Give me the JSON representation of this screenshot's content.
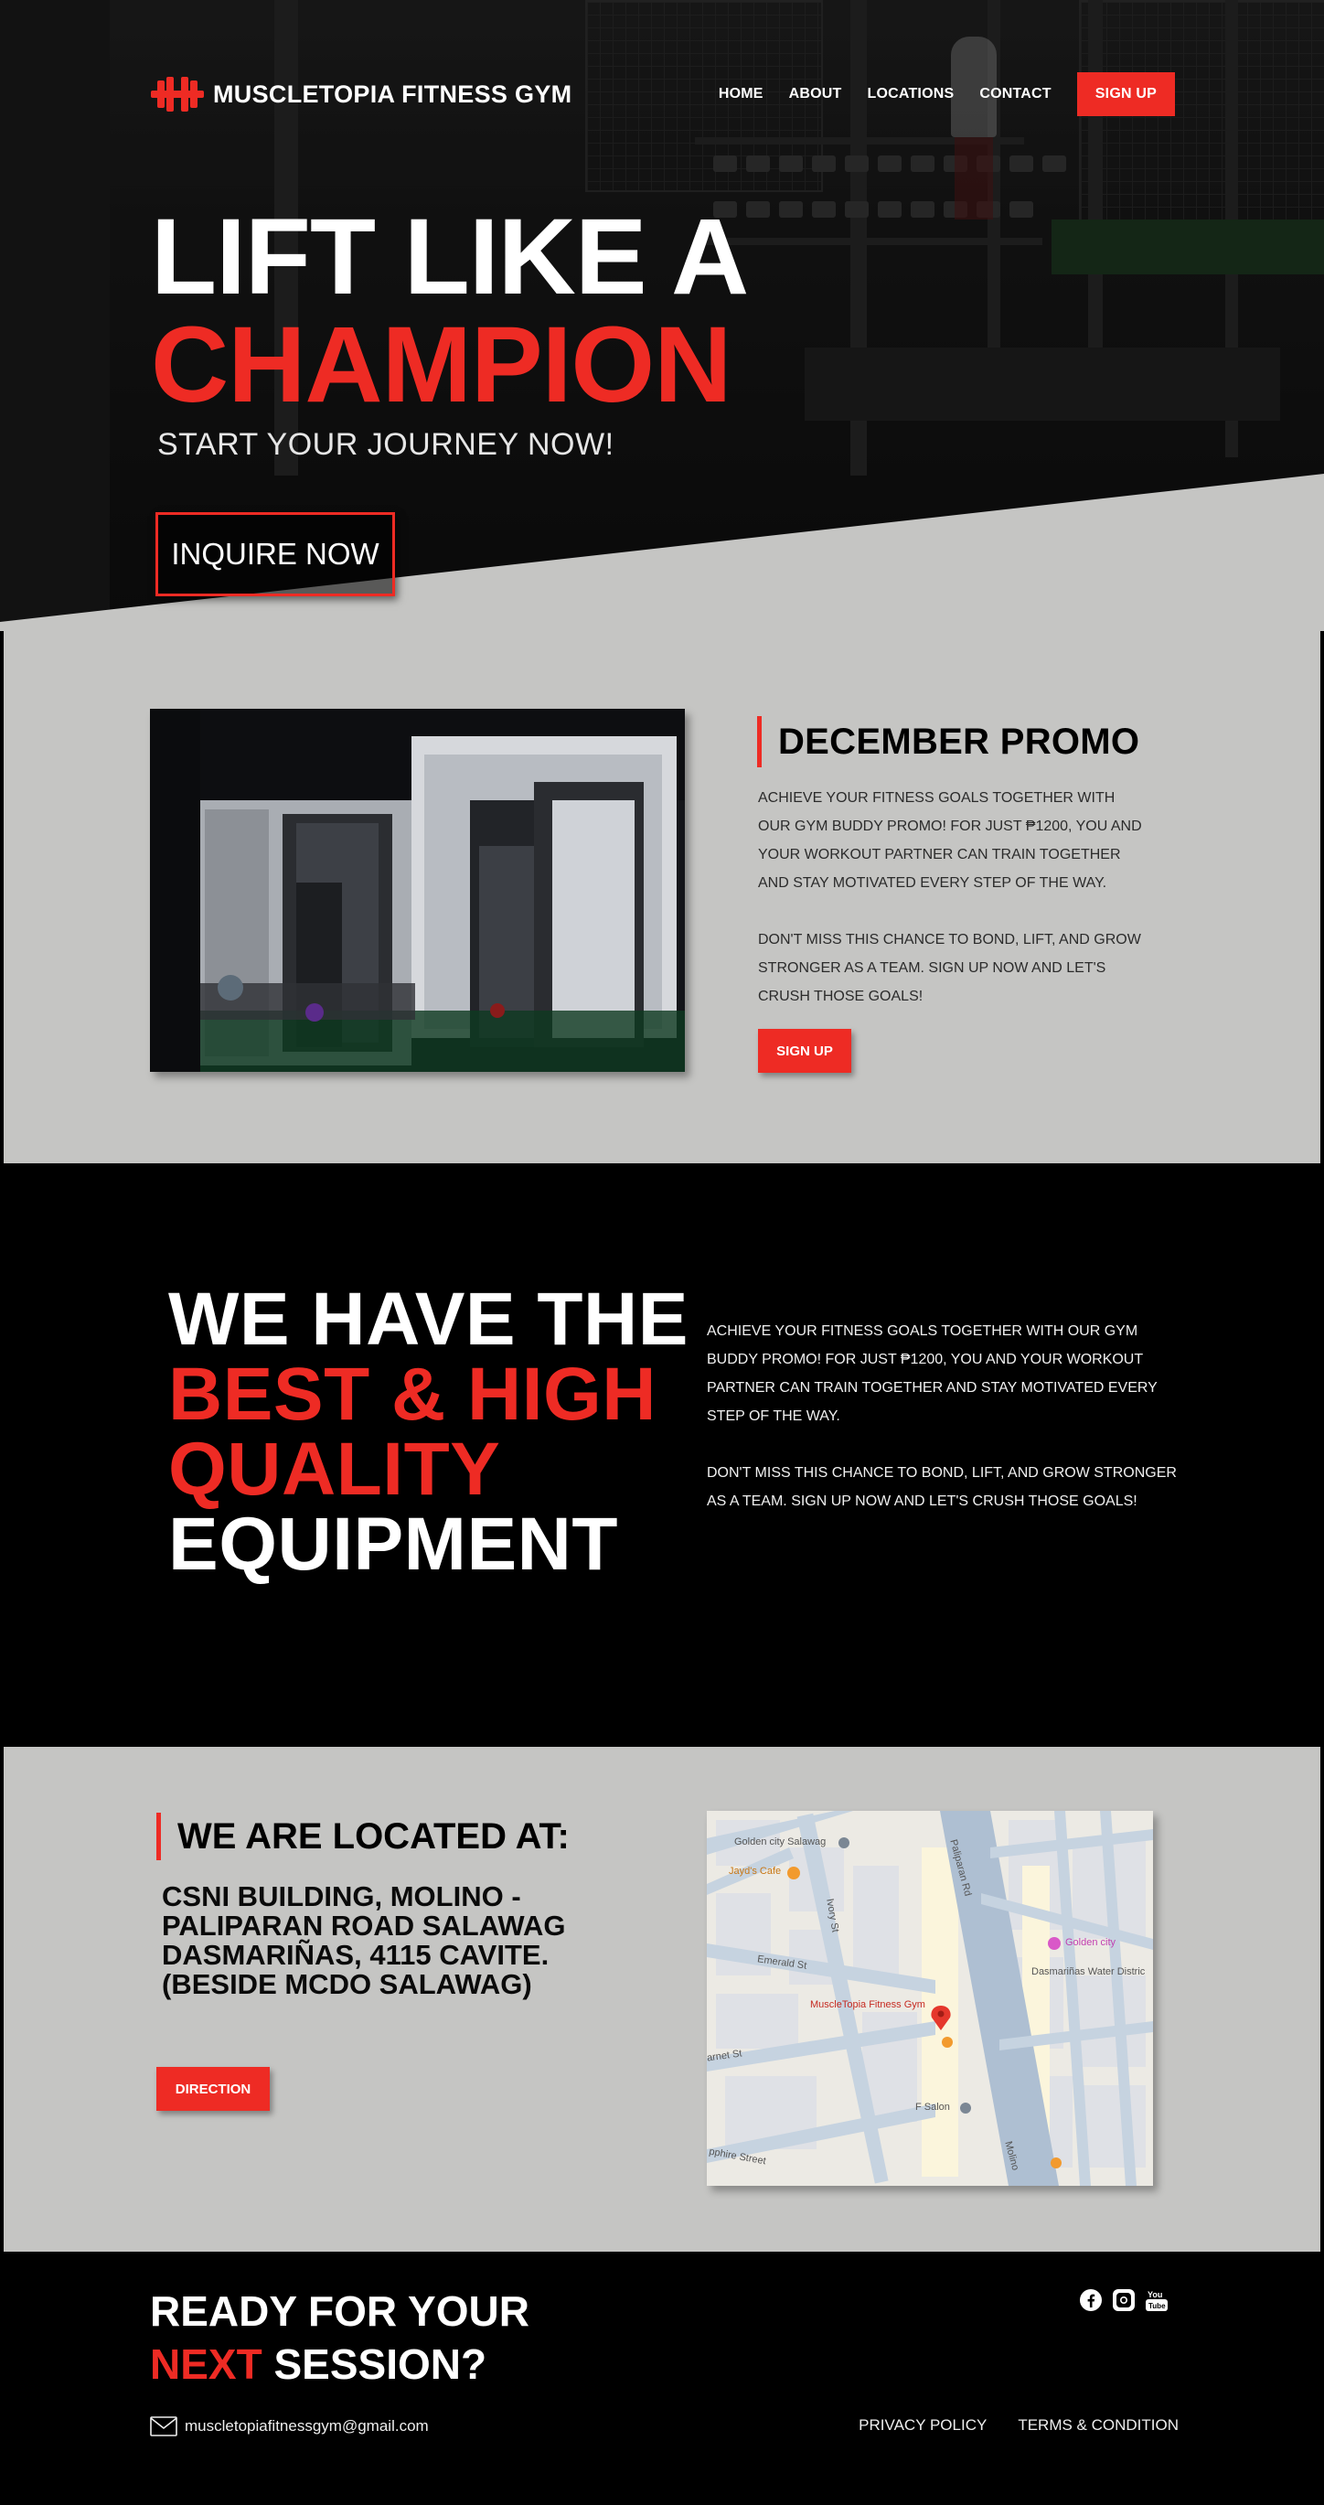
{
  "nav": {
    "brand": "MUSCLETOPIA FITNESS GYM",
    "items": [
      "HOME",
      "ABOUT",
      "LOCATIONS",
      "CONTACT"
    ],
    "signup": "SIGN UP"
  },
  "hero": {
    "line1": "LIFT LIKE A",
    "line2": "CHAMPION",
    "subtitle": "START YOUR JOURNEY NOW!",
    "cta": "INQUIRE NOW"
  },
  "promo": {
    "title": "DECEMBER PROMO",
    "paragraph1": "Achieve your fitness goals together with our Gym Buddy Promo!  For just ₱1200, you and your workout partner can train together and stay motivated every step of the way.",
    "paragraph2": "Don't miss this chance to bond, lift, and grow stronger as a team. Sign up now and let's crush those goals!",
    "button": "SIGN UP"
  },
  "equipment": {
    "line1": "WE HAVE THE",
    "line2": "BEST & HIGH",
    "line3": "QUALITY",
    "line4": "EQUIPMENT",
    "paragraph1": "Achieve your fitness goals together with our Gym Buddy Promo!  For just ₱1200, you and your workout partner can train together and stay motivated every step of the way.",
    "paragraph2": "Don't miss this chance to bond, lift, and grow stronger as a team. Sign up now and let's crush those goals!"
  },
  "location": {
    "title": "WE ARE LOCATED AT:",
    "address_lines": [
      "CSNI BUILDING, MOLINO -",
      "PALIPARAN ROAD SALAWAG",
      "DASMARIÑAS, 4115 CAVITE.",
      "(BESIDE MCDO SALAWAG)"
    ],
    "button": "DIRECTION",
    "map_labels": {
      "golden_city_salawag": "Golden city Salawag",
      "jayds_cafe": "Jayd's Cafe",
      "paliparan_rd": "Paliparan Rd",
      "ivory_st": "Ivory St",
      "golden_city": "Golden city",
      "emerald_st": "Emerald St",
      "dasmarinas_water": "Dasmariñas Water Distric",
      "gym_pin": "MuscleTopia Fitness Gym",
      "garnet_st": "arnet St",
      "f_salon": "F Salon",
      "sapphire_st": "pphire Street",
      "molino": "Molino"
    }
  },
  "footer": {
    "line1": "READY FOR YOUR",
    "line2_red": "NEXT",
    "line2_white": " SESSION?",
    "email": "muscletopiafitnessgym@gmail.com",
    "links": [
      "PRIVACY POLICY",
      "TERMS & CONDITION"
    ],
    "socials": [
      "facebook-icon",
      "instagram-icon",
      "youtube-icon"
    ]
  },
  "colors": {
    "accent": "#ee2b24",
    "light_bg": "#c5c5c3",
    "dark_bg": "#000000"
  }
}
